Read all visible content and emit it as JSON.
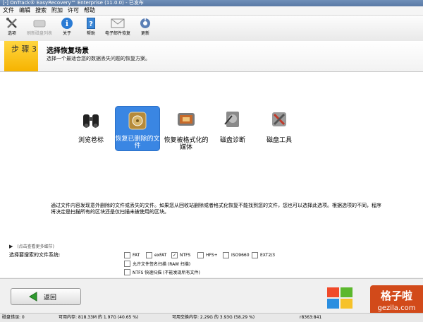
{
  "window": {
    "title": "[-] OnTrack® EasyRecovery™ Enterprise (11.0.0) - 已发布"
  },
  "menu": [
    "文件",
    "编辑",
    "搜索",
    "附加",
    "许可",
    "帮助"
  ],
  "toolbar": [
    {
      "label": "选项",
      "icon": "tools-icon",
      "enabled": true
    },
    {
      "label": "刷新磁盘列表",
      "icon": "refresh-disk-icon",
      "enabled": false
    },
    {
      "label": "关于",
      "icon": "info-icon",
      "enabled": true
    },
    {
      "label": "帮助",
      "icon": "help-book-icon",
      "enabled": true
    },
    {
      "label": "电子邮件恢复",
      "icon": "mail-icon",
      "enabled": true
    },
    {
      "label": "更新",
      "icon": "update-icon",
      "enabled": true
    }
  ],
  "step": {
    "label": "步 骤  3",
    "title": "选择恢复场景",
    "subtitle": "选择一个最适合您的数据丢失问题的恢复方案。"
  },
  "options": [
    {
      "label": "浏览卷标",
      "icon": "binoculars-icon",
      "selected": false
    },
    {
      "label": "恢复已删除的文件",
      "icon": "deleted-file-recovery-icon",
      "selected": true
    },
    {
      "label": "恢复被格式化的媒体",
      "icon": "formatted-media-icon",
      "selected": false
    },
    {
      "label": "磁盘诊断",
      "icon": "disk-diagnostic-icon",
      "selected": false
    },
    {
      "label": "磁盘工具",
      "icon": "disk-tools-icon",
      "selected": false
    }
  ],
  "description": "通过文件内容发现意外删除的文件或丢失的文件。如果您从回收站删除或者格式化恢复不能找到您的文件，您也可以选择此选项。根据选项的不同，程序将决定是扫描所有的区块还是仅扫描未被使用的区块。",
  "more_details": "(点击查看更多细节)",
  "filesystem": {
    "label": "选择要搜索的文件系统:",
    "options": [
      {
        "label": "FAT",
        "checked": false
      },
      {
        "label": "exFAT",
        "checked": false
      },
      {
        "label": "NTFS",
        "checked": true
      },
      {
        "label": "HFS+",
        "checked": false
      },
      {
        "label": "ISO9660",
        "checked": false
      },
      {
        "label": "EXT2/3",
        "checked": false
      }
    ],
    "extra": [
      {
        "label": "允许文件签名扫描 (RAW 扫描)",
        "checked": false
      },
      {
        "label": "NTFS 快速扫描 (不能发现所有文件)",
        "checked": false
      }
    ]
  },
  "back_button": "返回",
  "watermark": {
    "line1": "格子啦",
    "line2": "gezila.com"
  },
  "status": {
    "disk_errors": "磁盘错误: 0",
    "avail_mem": "可用内存: 818.33M 的 1.97G (40.65 %)",
    "avail_swap": "可用交换内存: 2.29G 的 3.93G (58.29 %)",
    "build": "r8363:841"
  },
  "colors": {
    "accent_yellow": "#f6b300",
    "selection_blue": "#3a86e3",
    "watermark_orange": "#d24a1a"
  }
}
